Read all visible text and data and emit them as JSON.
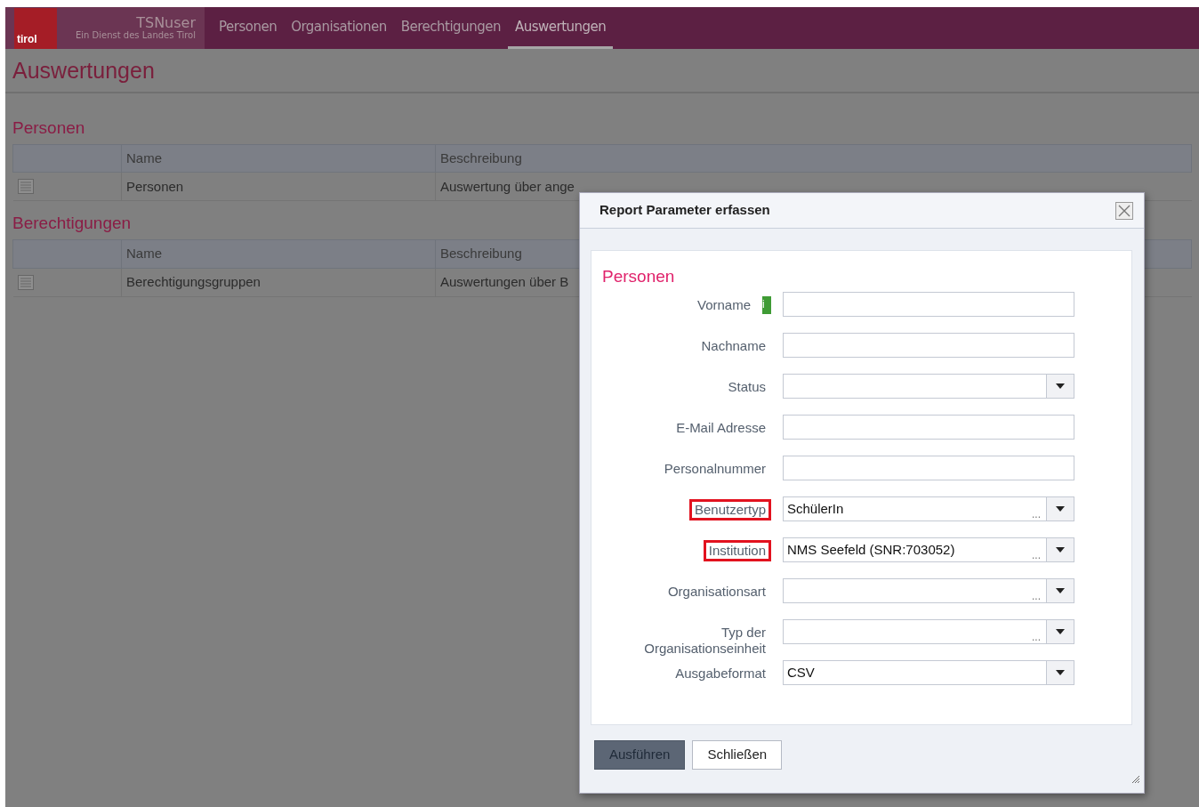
{
  "header": {
    "app_name": "TSNuser",
    "subtitle": "Ein Dienst des Landes Tirol",
    "logo_text": "tirol"
  },
  "nav": [
    {
      "label": "Personen",
      "selected": false
    },
    {
      "label": "Organisationen",
      "selected": false
    },
    {
      "label": "Berechtigungen",
      "selected": false
    },
    {
      "label": "Auswertungen",
      "selected": true
    }
  ],
  "page_title": "Auswertungen",
  "sections": [
    {
      "title": "Personen",
      "columns": [
        "Name",
        "Beschreibung"
      ],
      "rows": [
        {
          "name": "Personen",
          "description": "Auswertung über ange"
        }
      ]
    },
    {
      "title": "Berechtigungen",
      "columns": [
        "Name",
        "Beschreibung"
      ],
      "rows": [
        {
          "name": "Berechtigungsgruppen",
          "description": "Auswertungen über B"
        }
      ]
    }
  ],
  "dialog": {
    "title": "Report Parameter erfassen",
    "section_title": "Personen",
    "fields": [
      {
        "label": "Vorname",
        "kind": "text",
        "info_icon": "i",
        "highlighted": false
      },
      {
        "label": "Nachname",
        "kind": "text",
        "highlighted": false
      },
      {
        "label": "Status",
        "kind": "select",
        "highlighted": false
      },
      {
        "label": "E-Mail Adresse",
        "kind": "text",
        "highlighted": false
      },
      {
        "label": "Personalnummer",
        "kind": "text",
        "highlighted": false
      },
      {
        "label": "Benutzertyp",
        "kind": "combo",
        "value": "SchülerIn",
        "more": "...",
        "highlighted": true
      },
      {
        "label": "Institution",
        "kind": "combo",
        "value": "NMS Seefeld (SNR:703052)",
        "more": "...",
        "highlighted": true
      },
      {
        "label": "Organisationsart",
        "kind": "combo",
        "more": "...",
        "highlighted": false
      },
      {
        "label": "Typ der Organisationseinheit",
        "kind": "combo",
        "more": "...",
        "highlighted": false
      },
      {
        "label": "Ausgabeformat",
        "kind": "select",
        "value": "CSV",
        "highlighted": false
      }
    ],
    "buttons": [
      {
        "label": "Ausführen",
        "primary": true
      },
      {
        "label": "Schließen",
        "primary": false
      }
    ]
  }
}
